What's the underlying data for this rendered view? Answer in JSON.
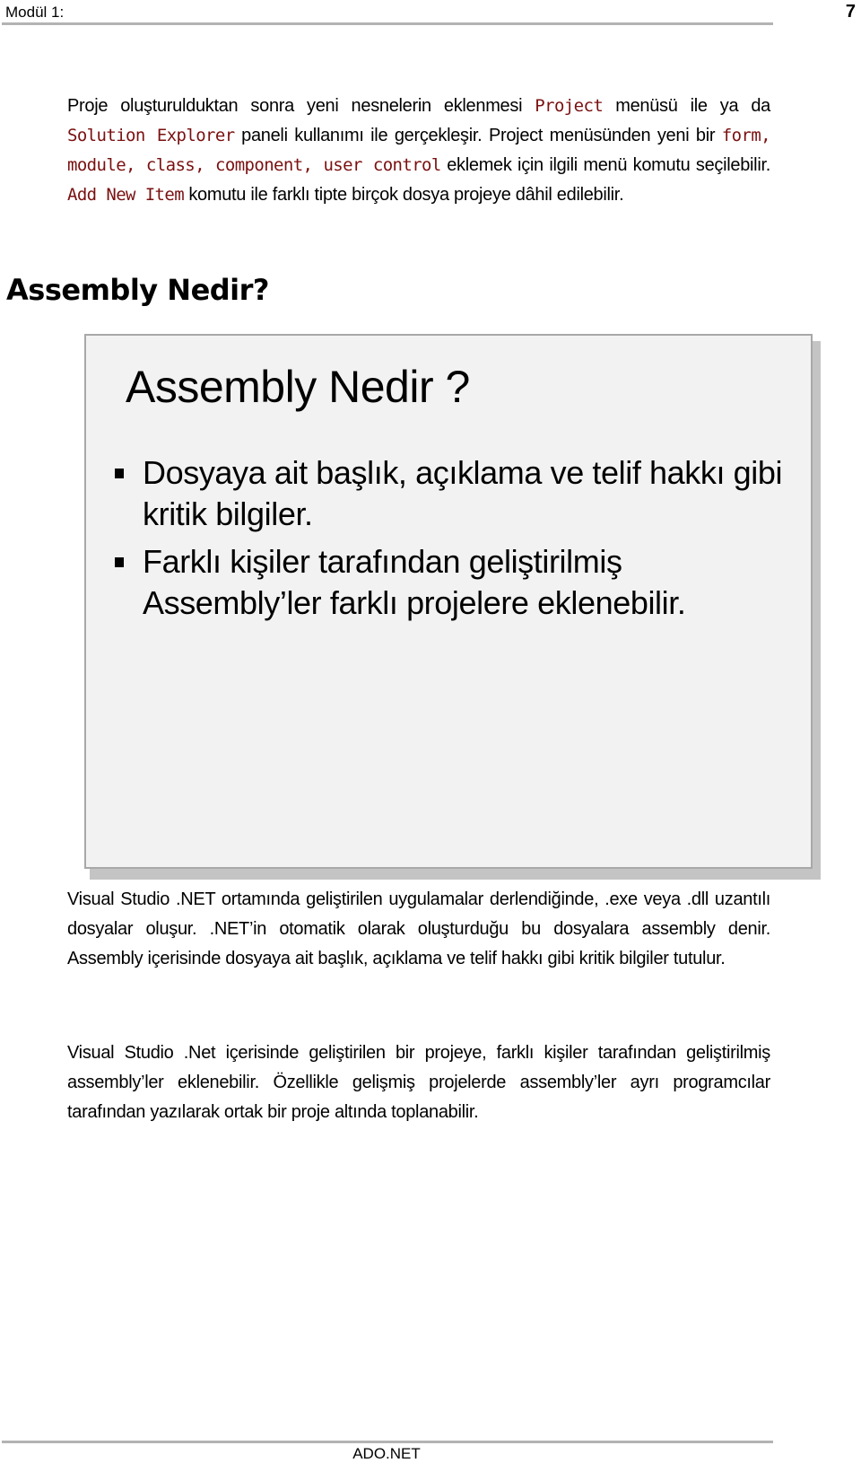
{
  "header": {
    "module_label": "Modül 1:",
    "page_number": "7"
  },
  "intro_paragraph": {
    "t1": "Proje oluşturulduktan sonra yeni nesnelerin eklenmesi ",
    "c1": "Project",
    "t2": " menüsü ile ya da ",
    "c2": "Solution Explorer",
    "t3": " paneli kullanımı ile gerçekleşir. Project menüsünden yeni bir ",
    "c3": "form, module, class, component, user control",
    "t4": " eklemek için ilgili menü komutu seçilebilir. ",
    "c4": "Add New Item",
    "t5": " komutu ile farklı tipte birçok dosya projeye dâhil edilebilir."
  },
  "section": {
    "title": "Assembly Nedir?"
  },
  "slide": {
    "title": "Assembly Nedir ?",
    "bullets": [
      "Dosyaya ait başlık, açıklama ve telif hakkı gibi kritik bilgiler.",
      "Farklı kişiler tarafından geliştirilmiş Assembly’ler farklı projelere eklenebilir."
    ]
  },
  "paragraphs": [
    "Visual Studio .NET ortamında geliştirilen uygulamalar derlendiğinde, .exe veya .dll uzantılı  dosyalar oluşur. .NET’in otomatik olarak oluşturduğu bu dosyalara assembly denir. Assembly içerisinde dosyaya ait başlık, açıklama ve telif hakkı gibi kritik bilgiler tutulur.",
    "Visual Studio .Net içerisinde geliştirilen bir  projeye, farklı kişiler tarafından geliştirilmiş assembly’ler eklenebilir. Özellikle gelişmiş projelerde assembly’ler ayrı programcılar tarafından yazılarak ortak bir proje altında toplanabilir."
  ],
  "footer": {
    "title": "ADO.NET"
  },
  "colors": {
    "code_text": "#7a1010",
    "slide_background": "#f2f2f2",
    "rule": "#b3b3b3"
  }
}
